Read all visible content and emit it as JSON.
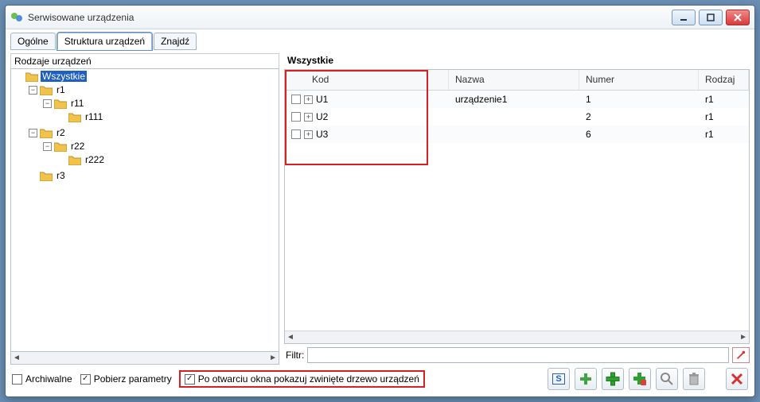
{
  "window": {
    "title": "Serwisowane urządzenia"
  },
  "tabs": {
    "t0": "Ogólne",
    "t1": "Struktura urządzeń",
    "t2": "Znajdź"
  },
  "left": {
    "header": "Rodzaje urządzeń",
    "root": "Wszystkie",
    "nodes": {
      "r1": "r1",
      "r11": "r11",
      "r111": "r111",
      "r2": "r2",
      "r22": "r22",
      "r222": "r222",
      "r3": "r3"
    }
  },
  "right": {
    "title": "Wszystkie",
    "columns": {
      "kod": "Kod",
      "nazwa": "Nazwa",
      "numer": "Numer",
      "rodzaj": "Rodzaj"
    },
    "rows": [
      {
        "kod": "U1",
        "nazwa": "urządzenie1",
        "numer": "1",
        "rodzaj": "r1"
      },
      {
        "kod": "U2",
        "nazwa": "",
        "numer": "2",
        "rodzaj": "r1"
      },
      {
        "kod": "U3",
        "nazwa": "",
        "numer": "6",
        "rodzaj": "r1"
      }
    ]
  },
  "filter": {
    "label": "Filtr:",
    "value": ""
  },
  "bottom": {
    "archive": "Archiwalne",
    "fetch": "Pobierz parametry",
    "collapse": "Po otwarciu okna pokazuj zwinięte drzewo urządzeń"
  },
  "icons": {
    "s": "S"
  }
}
